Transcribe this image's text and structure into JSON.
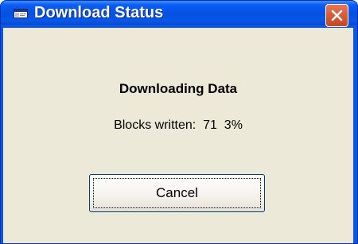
{
  "window": {
    "title": "Download Status",
    "icon": "app-window-icon",
    "close_icon": "close-icon"
  },
  "status": {
    "heading": "Downloading Data",
    "blocks_label": "Blocks written:",
    "blocks_count": "71",
    "percent": "3%"
  },
  "actions": {
    "cancel_label": "Cancel"
  },
  "colors": {
    "titlebar": "#0450e3",
    "client": "#ece9d8",
    "close_button": "#d65a36"
  }
}
